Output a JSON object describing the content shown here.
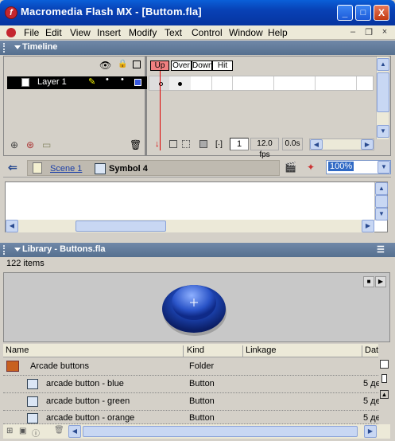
{
  "window": {
    "title": "Macromedia Flash MX - [Buttom.fla]",
    "controls": {
      "minimize": "_",
      "maximize": "□",
      "close": "X"
    }
  },
  "menubar": {
    "items": [
      "File",
      "Edit",
      "View",
      "Insert",
      "Modify",
      "Text",
      "Control",
      "Window",
      "Help"
    ]
  },
  "timeline": {
    "title": "Timeline",
    "layer_name": "Layer 1",
    "frame_labels": [
      "Up",
      "Over",
      "Down",
      "Hit"
    ],
    "current_frame": "1",
    "frame_rate": "12.0 fps",
    "elapsed_time": "0.0s"
  },
  "editbar": {
    "scene": "Scene 1",
    "symbol": "Symbol 4",
    "zoom": "100%"
  },
  "library": {
    "title": "Library - Buttons.fla",
    "item_count": "122 items",
    "columns": [
      "Name",
      "Kind",
      "Linkage",
      "Dat"
    ],
    "items": [
      {
        "name": "Arcade buttons",
        "kind": "Folder",
        "date": ""
      },
      {
        "name": "arcade button - blue",
        "kind": "Button",
        "date": "5 де"
      },
      {
        "name": "arcade button - green",
        "kind": "Button",
        "date": "5 де"
      },
      {
        "name": "arcade button - orange",
        "kind": "Button",
        "date": "5 де"
      }
    ]
  },
  "colors": {
    "titlebar": "#0841b5",
    "panel_header": "#56708f",
    "frame_label_active": "#f08080",
    "button_preview": "#1a3fa8"
  }
}
